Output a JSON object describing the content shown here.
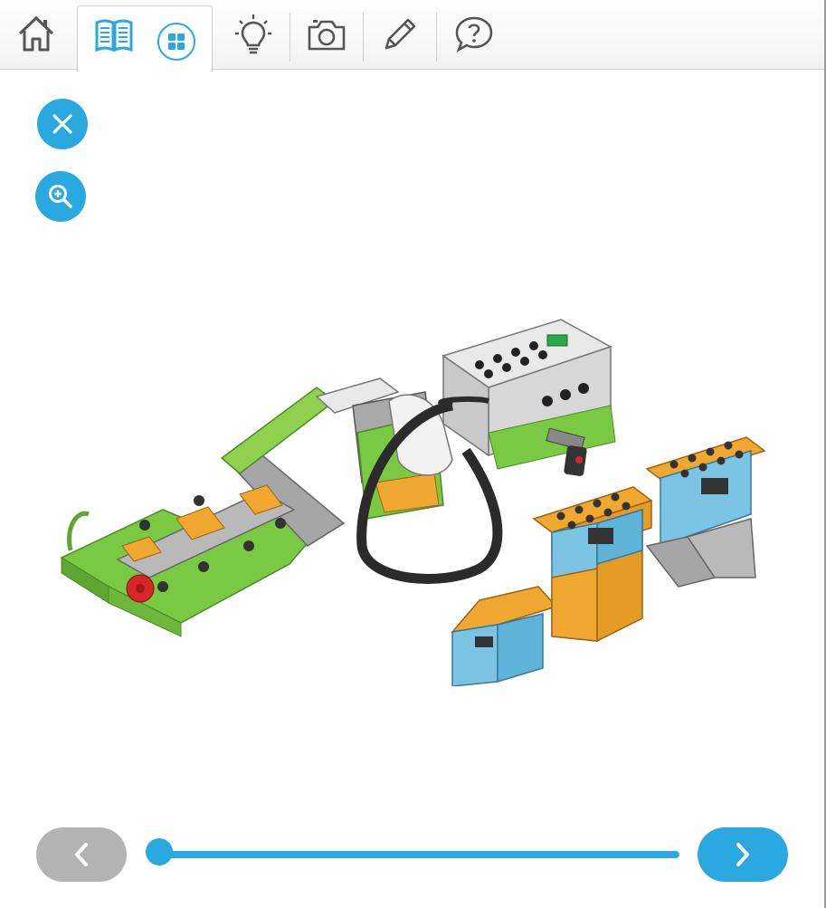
{
  "toolbar": {
    "items": [
      {
        "name": "home-icon"
      },
      {
        "name": "build-instructions-icon",
        "active": true
      },
      {
        "name": "grid-icon"
      },
      {
        "name": "lightbulb-icon"
      },
      {
        "name": "camera-icon"
      },
      {
        "name": "pencil-icon"
      },
      {
        "name": "help-icon"
      }
    ]
  },
  "side_buttons": [
    {
      "name": "close-icon"
    },
    {
      "name": "zoom-in-icon"
    }
  ],
  "navigation": {
    "prev_icon": "chevron-left-icon",
    "next_icon": "chevron-right-icon",
    "step_progress": 0.0
  },
  "colors": {
    "accent": "#2aa8e0",
    "prev_button": "#b3b3b3",
    "icon_gray": "#555555",
    "lego_green": "#7ac943",
    "lego_orange": "#f0a830",
    "lego_blue": "#7cc4e4",
    "lego_white": "#e9e9e9",
    "lego_dark": "#333333",
    "lego_gray": "#9a9a9a",
    "lego_red": "#d62828"
  }
}
